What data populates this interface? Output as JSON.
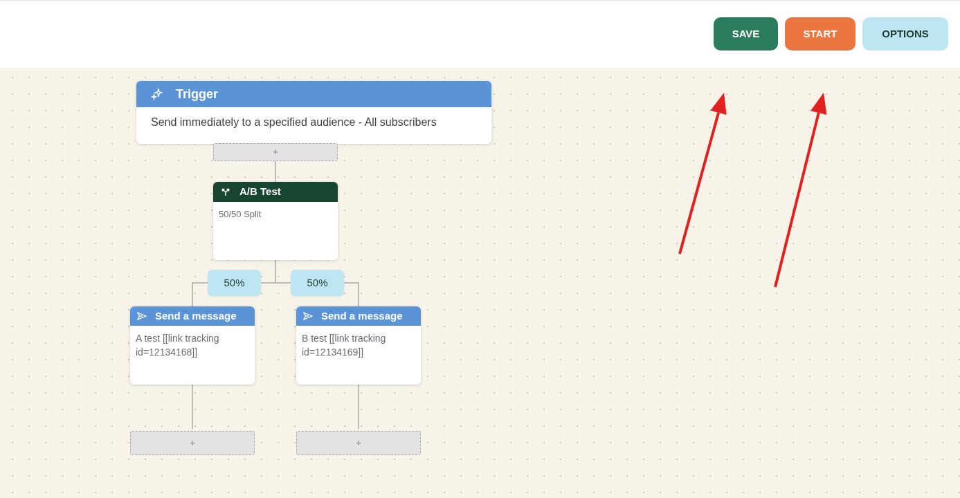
{
  "toolbar": {
    "buttons": [
      {
        "label": "SAVE",
        "kind": "save"
      },
      {
        "label": "START",
        "kind": "start"
      },
      {
        "label": "OPTIONS",
        "kind": "options"
      }
    ]
  },
  "flow": {
    "trigger": {
      "title": "Trigger",
      "description": "Send immediately to a specified audience - All subscribers"
    },
    "add_step": "+",
    "ab_test": {
      "title": "A/B Test",
      "description": "50/50 Split"
    },
    "branches": [
      {
        "percent": "50%",
        "message": {
          "title": "Send a message",
          "description": "A test [[link tracking id=12134168]]"
        },
        "add_step": "+"
      },
      {
        "percent": "50%",
        "message": {
          "title": "Send a message",
          "description": "B test [[link tracking id=12134169]]"
        },
        "add_step": "+"
      }
    ]
  }
}
